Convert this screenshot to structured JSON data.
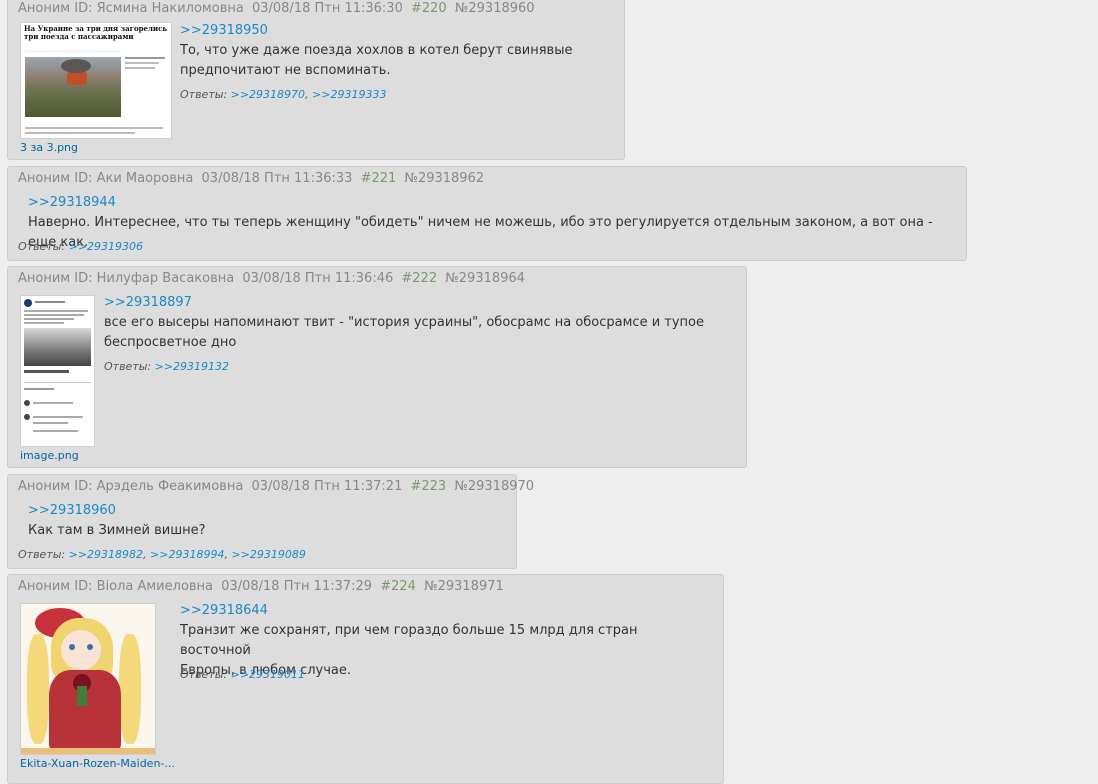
{
  "posts": [
    {
      "name": "Аноним ID: Ясмина Накиломовна",
      "date": "03/08/18 Птн 11:36:30",
      "index": "#220",
      "num": "№29318960",
      "file": "3 за 3.png",
      "thumb_headline": "На Украине за три дня загорелись три поезда с пассажирами",
      "reply_to": ">>29318950",
      "lines": [
        "То, что уже даже поезда хохлов в котел берут свинявые",
        "предпочитают не вспоминать."
      ],
      "answers_label": "Ответы:",
      "answers": [
        ">>29318970",
        ">>29319333"
      ]
    },
    {
      "name": "Аноним ID: Аки Маоровна",
      "date": "03/08/18 Птн 11:36:33",
      "index": "#221",
      "num": "№29318962",
      "reply_to": ">>29318944",
      "lines": [
        "Наверно. Интереснее, что ты теперь женщину \"обидеть\" ничем не можешь, ибо это регулируется отдельным законом, а вот она - еще как."
      ],
      "answers_label": "Ответы:",
      "answers": [
        ">>29319306"
      ]
    },
    {
      "name": "Аноним ID: Нилуфар Васаковна",
      "date": "03/08/18 Птн 11:36:46",
      "index": "#222",
      "num": "№29318964",
      "file": "image.png",
      "reply_to": ">>29318897",
      "lines": [
        "все его высеры напоминают твит - \"история усраины\", обосрамс на обосрамсе и тупое",
        "беспросветное дно"
      ],
      "answers_label": "Ответы:",
      "answers": [
        ">>29319132"
      ]
    },
    {
      "name": "Аноним ID: Арэдель Феакимовна",
      "date": "03/08/18 Птн 11:37:21",
      "index": "#223",
      "num": "№29318970",
      "reply_to": ">>29318960",
      "lines": [
        "Как там в Зимней вишне?"
      ],
      "answers_label": "Ответы:",
      "answers": [
        ">>29318982",
        ">>29318994",
        ">>29319089"
      ]
    },
    {
      "name": "Аноним ID: Віола Амиеловна",
      "date": "03/08/18 Птн 11:37:29",
      "index": "#224",
      "num": "№29318971",
      "file": "Ekita-Xuan-Rozen-Maiden-...",
      "reply_to": ">>29318644",
      "lines": [
        "Транзит же сохранят, при чем гораздо больше 15 млрд для стран восточной",
        "Европы, в любом случае."
      ],
      "answers_label": "Ответы:",
      "answers": [
        ">>29319011"
      ]
    }
  ],
  "colors": {
    "link": "#1a88c9",
    "post_bg": "#dddddd",
    "page_bg": "#eeeeee",
    "post_index": "#7a9a6e"
  }
}
